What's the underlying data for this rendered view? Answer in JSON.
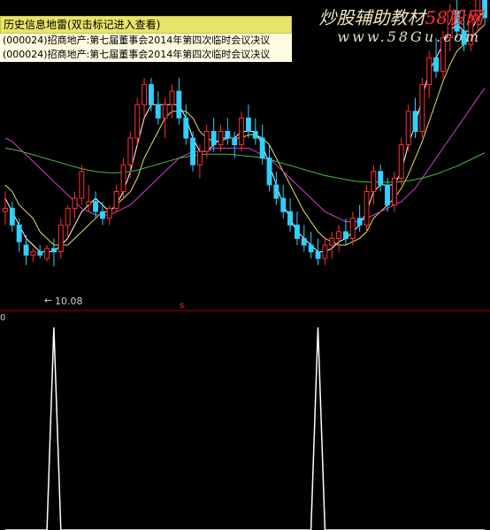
{
  "info_panel": {
    "title": "历史信息地雷(双击标记进入查看)",
    "lines": [
      "(000024)招商地产:第七届董事会2014年第四次临时会议决议",
      "(000024)招商地产:第七届董事会2014年第四次临时会议决议"
    ]
  },
  "watermark": {
    "text_main": "炒股辅助教材",
    "text_accent": "58股网",
    "url": "www.58Gu.com"
  },
  "low_price_label": "10.08",
  "separator_marker": "s",
  "sub_chart_label": "0",
  "colors": {
    "up": "#ff3030",
    "down": "#30d0ff",
    "ma_short": "#ffffff",
    "ma_mid": "#e8e060",
    "ma_long": "#d040d0",
    "ma_longest": "#40c040",
    "separator": "#a00000",
    "spike": "#ffffff"
  },
  "chart_data": [
    {
      "type": "candlestick",
      "ylim": [
        9.5,
        13.8
      ],
      "annotations": [
        {
          "text": "10.08",
          "index": 7
        }
      ],
      "candles": [
        [
          10.9,
          11.2,
          10.7,
          10.95
        ],
        [
          10.95,
          11.05,
          10.6,
          10.7
        ],
        [
          10.7,
          10.8,
          10.3,
          10.45
        ],
        [
          10.4,
          10.55,
          10.1,
          10.25
        ],
        [
          10.25,
          10.35,
          10.15,
          10.3
        ],
        [
          10.3,
          10.4,
          10.2,
          10.25
        ],
        [
          10.2,
          10.4,
          10.15,
          10.35
        ],
        [
          10.35,
          10.5,
          10.08,
          10.3
        ],
        [
          10.3,
          10.8,
          10.2,
          10.7
        ],
        [
          10.7,
          11.0,
          10.5,
          10.95
        ],
        [
          10.95,
          11.2,
          10.8,
          11.1
        ],
        [
          11.1,
          11.6,
          11.0,
          11.5
        ],
        [
          11.0,
          11.3,
          10.9,
          11.05
        ],
        [
          11.05,
          11.2,
          10.8,
          10.9
        ],
        [
          10.9,
          11.05,
          10.7,
          10.8
        ],
        [
          10.8,
          11.0,
          10.7,
          10.95
        ],
        [
          10.95,
          11.3,
          10.9,
          11.2
        ],
        [
          11.2,
          11.7,
          11.1,
          11.6
        ],
        [
          11.6,
          12.1,
          11.4,
          12.0
        ],
        [
          12.0,
          12.6,
          11.9,
          12.5
        ],
        [
          12.5,
          12.9,
          12.3,
          12.8
        ],
        [
          12.8,
          12.9,
          12.4,
          12.5
        ],
        [
          12.5,
          12.7,
          12.2,
          12.3
        ],
        [
          12.3,
          12.6,
          12.0,
          12.5
        ],
        [
          12.5,
          12.8,
          12.3,
          12.7
        ],
        [
          12.7,
          12.9,
          12.2,
          12.3
        ],
        [
          12.3,
          12.5,
          11.9,
          12.0
        ],
        [
          12.0,
          12.1,
          11.5,
          11.6
        ],
        [
          11.6,
          11.9,
          11.4,
          11.8
        ],
        [
          11.8,
          12.2,
          11.7,
          12.1
        ],
        [
          12.1,
          12.3,
          11.8,
          11.9
        ],
        [
          11.9,
          12.2,
          11.8,
          12.1
        ],
        [
          12.1,
          12.3,
          11.9,
          12.0
        ],
        [
          12.0,
          12.1,
          11.7,
          11.9
        ],
        [
          11.9,
          12.4,
          11.8,
          12.3
        ],
        [
          12.3,
          12.5,
          12.0,
          12.1
        ],
        [
          12.1,
          12.3,
          11.9,
          12.0
        ],
        [
          12.0,
          12.2,
          11.6,
          11.7
        ],
        [
          11.7,
          11.9,
          11.2,
          11.3
        ],
        [
          11.3,
          11.5,
          11.0,
          11.1
        ],
        [
          11.1,
          11.3,
          10.8,
          10.9
        ],
        [
          10.9,
          11.1,
          10.6,
          10.7
        ],
        [
          10.7,
          10.9,
          10.4,
          10.5
        ],
        [
          10.5,
          10.7,
          10.3,
          10.4
        ],
        [
          10.4,
          10.6,
          10.2,
          10.3
        ],
        [
          10.3,
          10.5,
          10.1,
          10.2
        ],
        [
          10.2,
          10.5,
          10.1,
          10.4
        ],
        [
          10.4,
          10.6,
          10.2,
          10.5
        ],
        [
          10.5,
          10.7,
          10.3,
          10.6
        ],
        [
          10.6,
          10.8,
          10.4,
          10.5
        ],
        [
          10.5,
          10.9,
          10.4,
          10.8
        ],
        [
          10.8,
          11.0,
          10.6,
          10.7
        ],
        [
          10.7,
          11.3,
          10.6,
          11.2
        ],
        [
          11.2,
          11.6,
          11.0,
          11.5
        ],
        [
          11.5,
          11.6,
          11.2,
          11.3
        ],
        [
          11.3,
          11.4,
          10.9,
          11.0
        ],
        [
          11.0,
          11.5,
          10.9,
          11.4
        ],
        [
          11.4,
          12.0,
          11.3,
          11.9
        ],
        [
          11.9,
          12.5,
          11.8,
          12.4
        ],
        [
          12.4,
          12.6,
          12.0,
          12.1
        ],
        [
          12.1,
          12.9,
          12.0,
          12.8
        ],
        [
          12.8,
          13.3,
          12.6,
          13.2
        ],
        [
          13.2,
          13.5,
          12.9,
          13.0
        ],
        [
          13.0,
          13.6,
          12.9,
          13.5
        ],
        [
          13.5,
          14.0,
          13.3,
          13.9
        ],
        [
          13.9,
          14.2,
          13.5,
          13.6
        ],
        [
          13.6,
          13.9,
          13.3,
          13.4
        ],
        [
          13.4,
          13.9,
          13.3,
          13.8
        ],
        [
          13.8,
          14.2,
          13.6,
          14.1
        ],
        [
          14.1,
          14.3,
          13.7,
          13.8
        ]
      ],
      "series": [
        {
          "name": "",
          "color_key": "ma_short",
          "values": [
            11.1,
            10.9,
            10.7,
            10.5,
            10.4,
            10.3,
            10.3,
            10.3,
            10.4,
            10.5,
            10.7,
            10.9,
            11.0,
            11.1,
            11.0,
            10.9,
            11.0,
            11.2,
            11.5,
            11.9,
            12.3,
            12.5,
            12.5,
            12.5,
            12.5,
            12.5,
            12.3,
            12.0,
            11.8,
            11.8,
            11.9,
            12.0,
            12.0,
            12.0,
            12.1,
            12.1,
            12.1,
            11.9,
            11.6,
            11.3,
            11.0,
            10.8,
            10.6,
            10.5,
            10.4,
            10.3,
            10.3,
            10.35,
            10.45,
            10.5,
            10.6,
            10.7,
            10.9,
            11.2,
            11.3,
            11.3,
            11.3,
            11.5,
            11.9,
            12.2,
            12.6,
            13.0,
            13.2,
            13.4,
            13.6,
            13.7,
            13.6,
            13.6,
            13.8,
            13.9
          ]
        },
        {
          "name": "",
          "color_key": "ma_mid",
          "values": [
            11.3,
            11.2,
            11.0,
            10.9,
            10.8,
            10.6,
            10.5,
            10.4,
            10.4,
            10.4,
            10.5,
            10.6,
            10.7,
            10.8,
            10.9,
            10.9,
            11.0,
            11.1,
            11.2,
            11.4,
            11.7,
            11.9,
            12.1,
            12.3,
            12.4,
            12.4,
            12.4,
            12.3,
            12.1,
            12.0,
            11.95,
            11.95,
            12.0,
            12.0,
            12.0,
            12.05,
            12.05,
            12.0,
            11.9,
            11.7,
            11.5,
            11.3,
            11.1,
            10.9,
            10.75,
            10.6,
            10.5,
            10.45,
            10.4,
            10.4,
            10.45,
            10.5,
            10.6,
            10.8,
            10.9,
            11.0,
            11.1,
            11.25,
            11.45,
            11.7,
            11.95,
            12.25,
            12.55,
            12.85,
            13.1,
            13.3,
            13.4,
            13.5,
            13.6,
            13.7
          ]
        },
        {
          "name": "",
          "color_key": "ma_long",
          "values": [
            12.0,
            11.95,
            11.85,
            11.75,
            11.65,
            11.55,
            11.45,
            11.35,
            11.25,
            11.15,
            11.05,
            10.95,
            10.9,
            10.85,
            10.85,
            10.85,
            10.9,
            10.95,
            11.0,
            11.1,
            11.2,
            11.3,
            11.4,
            11.5,
            11.6,
            11.7,
            11.75,
            11.8,
            11.8,
            11.8,
            11.85,
            11.85,
            11.85,
            11.85,
            11.85,
            11.85,
            11.8,
            11.75,
            11.7,
            11.6,
            11.5,
            11.4,
            11.3,
            11.2,
            11.1,
            11.0,
            10.9,
            10.85,
            10.8,
            10.75,
            10.75,
            10.75,
            10.8,
            10.85,
            10.9,
            10.95,
            11.0,
            11.05,
            11.15,
            11.25,
            11.4,
            11.55,
            11.7,
            11.85,
            12.0,
            12.15,
            12.3,
            12.45,
            12.6,
            12.75
          ]
        },
        {
          "name": "",
          "color_key": "ma_longest",
          "values": [
            11.85,
            11.83,
            11.81,
            11.78,
            11.75,
            11.72,
            11.69,
            11.66,
            11.63,
            11.6,
            11.57,
            11.54,
            11.52,
            11.5,
            11.49,
            11.48,
            11.48,
            11.49,
            11.5,
            11.52,
            11.55,
            11.58,
            11.61,
            11.64,
            11.67,
            11.7,
            11.72,
            11.74,
            11.75,
            11.76,
            11.76,
            11.76,
            11.76,
            11.75,
            11.74,
            11.73,
            11.72,
            11.7,
            11.68,
            11.65,
            11.62,
            11.59,
            11.56,
            11.53,
            11.5,
            11.47,
            11.44,
            11.42,
            11.4,
            11.38,
            11.36,
            11.35,
            11.34,
            11.34,
            11.34,
            11.34,
            11.34,
            11.35,
            11.36,
            11.38,
            11.4,
            11.43,
            11.46,
            11.5,
            11.54,
            11.58,
            11.63,
            11.68,
            11.73,
            11.78
          ]
        }
      ]
    },
    {
      "type": "line",
      "ylim": [
        0,
        1
      ],
      "series": [
        {
          "name": "",
          "color_key": "spike",
          "values": [
            0,
            0,
            0,
            0,
            0,
            0,
            0,
            1,
            0,
            0,
            0,
            0,
            0,
            0,
            0,
            0,
            0,
            0,
            0,
            0,
            0,
            0,
            0,
            0,
            0,
            0,
            0,
            0,
            0,
            0,
            0,
            0,
            0,
            0,
            0,
            0,
            0,
            0,
            0,
            0,
            0,
            0,
            0,
            0,
            0,
            1,
            0,
            0,
            0,
            0,
            0,
            0,
            0,
            0,
            0,
            0,
            0,
            0,
            0,
            0,
            0,
            0,
            0,
            0,
            0,
            0,
            0,
            0,
            0,
            0
          ]
        }
      ]
    }
  ]
}
